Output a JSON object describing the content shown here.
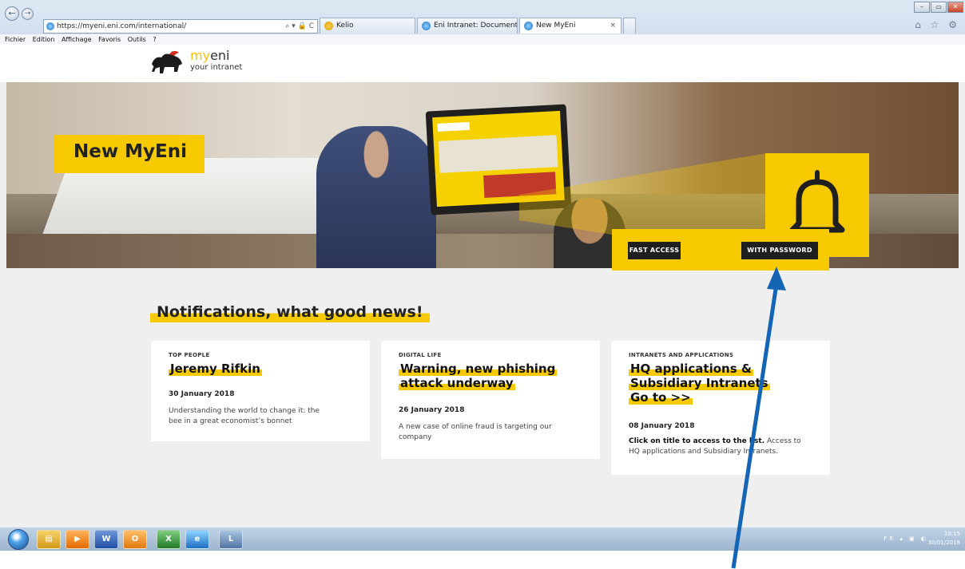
{
  "browser": {
    "url": "https://myeni.eni.com/international/",
    "tabs": [
      {
        "label": "Kelio"
      },
      {
        "label": "Eni Intranet: Documents"
      },
      {
        "label": "New MyEni",
        "active": true
      }
    ],
    "tab_close": "×",
    "menu": [
      "Fichier",
      "Edition",
      "Affichage",
      "Favoris",
      "Outils",
      "?"
    ],
    "addr_tools": "⌕ ▾ 🔒 C",
    "nav_back": "←",
    "nav_forward": "→",
    "window_buttons": {
      "minimize": "–",
      "maximize": "▭",
      "close": "✕"
    },
    "right_icons": "⌂ ☆ ⚙"
  },
  "site": {
    "logo_prefix": "my",
    "logo_main": "eni",
    "logo_sub": "your intranet",
    "hero_title": "New MyEni",
    "fast_access": "FAST ACCESS",
    "with_password": "WITH PASSWORD",
    "section_title": "Notifications, what good news!",
    "accent_color": "#f6c900"
  },
  "cards": [
    {
      "category": "TOP PEOPLE",
      "title_lines": [
        "Jeremy Rifkin"
      ],
      "date": "30 January 2018",
      "desc_lines": [
        "Understanding the world to change it: the",
        "bee in a great economist’s bonnet"
      ]
    },
    {
      "category": "DIGITAL LIFE",
      "title_lines": [
        "Warning, new phishing",
        "attack underway"
      ],
      "date": "26 January 2018",
      "desc_lines": [
        "A new case of online fraud is targeting our",
        "company"
      ]
    },
    {
      "category": "INTRANETS AND APPLICATIONS",
      "title_lines": [
        "HQ applications &",
        "Subsidiary Intranets",
        "Go to >>"
      ],
      "date": "08 January 2018",
      "desc_bold": "Click on title to access to the list.",
      "desc_rest": " Access to",
      "desc_line2": "HQ applications and Subsidiary Intranets."
    }
  ],
  "taskbar": {
    "apps": [
      {
        "name": "explorer",
        "glyph": "▤"
      },
      {
        "name": "media",
        "glyph": "▶"
      },
      {
        "name": "word",
        "glyph": "W"
      },
      {
        "name": "outlook",
        "glyph": "O"
      },
      {
        "name": "excel",
        "glyph": "X"
      },
      {
        "name": "ie",
        "glyph": "e"
      },
      {
        "name": "app",
        "glyph": "L"
      }
    ],
    "lang": "FR",
    "tray_icons": "▴ ▣ ◐",
    "time": "10:15",
    "date": "30/01/2018"
  }
}
